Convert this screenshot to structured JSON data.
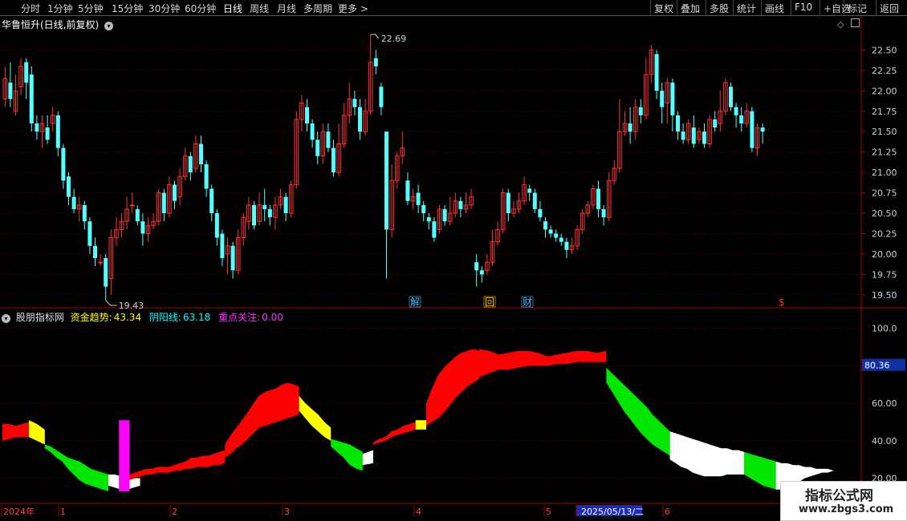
{
  "toolbar": {
    "periods": [
      "分时",
      "1分钟",
      "5分钟",
      "15分钟",
      "30分钟",
      "60分钟",
      "日线",
      "周线",
      "月线",
      "多周期",
      "更多 >"
    ],
    "active_period": "日线",
    "right_buttons": [
      "复权",
      "叠加",
      "多股",
      "统计",
      "画线",
      "F10",
      "+自选",
      "标记",
      "返回"
    ]
  },
  "main_chart": {
    "title": "华鲁恒升(日线,前复权)",
    "high_label": "22.69",
    "low_label": "19.43",
    "y_ticks": [
      "22.50",
      "22.25",
      "22.00",
      "21.75",
      "21.50",
      "21.25",
      "21.00",
      "20.75",
      "20.50",
      "20.25",
      "20.00",
      "19.75",
      "19.50"
    ],
    "markers": [
      {
        "text": "解",
        "color": "#4db8ff"
      },
      {
        "text": "回",
        "color": "#ffcc00"
      },
      {
        "text": "财",
        "color": "#4db8ff"
      },
      {
        "text": "$",
        "color": "#ff3030"
      }
    ]
  },
  "indicator": {
    "name": "股朋指标网",
    "fields": [
      {
        "label": "资金趋势:",
        "value": "43.34",
        "color": "#ffff00"
      },
      {
        "label": "阴阳线:",
        "value": "63.18",
        "color": "#00ffff"
      },
      {
        "label": "重点关注:",
        "value": "0.00",
        "color": "#ff33ff"
      }
    ],
    "y_ticks": [
      "100.0",
      "80.00",
      "60.00",
      "40.00",
      "20.00"
    ],
    "current_value": "80.36"
  },
  "time_axis": {
    "labels": [
      "2024年",
      "1",
      "2",
      "3",
      "4",
      "5",
      "2025/05/13/二",
      "6"
    ]
  },
  "watermark": {
    "line1": "指标公式网",
    "line2": "www.zbgs3.com"
  },
  "colors": {
    "up": "#ff3232",
    "down": "#54ffff",
    "red": "#ff0000",
    "yellow": "#ffff00",
    "green": "#00e600",
    "white": "#ffffff",
    "magenta": "#ff00ff"
  },
  "chart_data": {
    "type": "candlestick",
    "y_range": [
      19.4,
      22.72
    ],
    "candles": [
      [
        21.9,
        22.15,
        22.3,
        21.8
      ],
      [
        22.1,
        21.9,
        22.35,
        21.8
      ],
      [
        21.75,
        22.0,
        22.2,
        21.7
      ],
      [
        22.05,
        22.3,
        22.4,
        21.95
      ],
      [
        22.35,
        22.1,
        22.4,
        21.9
      ],
      [
        22.2,
        21.6,
        22.3,
        21.5
      ],
      [
        21.6,
        21.5,
        21.7,
        21.4
      ],
      [
        21.5,
        21.6,
        21.7,
        21.3
      ],
      [
        21.55,
        21.4,
        21.7,
        21.35
      ],
      [
        21.6,
        21.7,
        21.8,
        21.5
      ],
      [
        21.7,
        21.3,
        21.75,
        21.2
      ],
      [
        21.3,
        20.9,
        21.35,
        20.8
      ],
      [
        20.95,
        20.7,
        21.0,
        20.6
      ],
      [
        20.7,
        20.55,
        20.8,
        20.5
      ],
      [
        20.55,
        20.6,
        20.7,
        20.4
      ],
      [
        20.6,
        20.4,
        20.65,
        20.3
      ],
      [
        20.4,
        20.1,
        20.45,
        20.0
      ],
      [
        20.1,
        19.95,
        20.2,
        19.85
      ],
      [
        19.9,
        19.9,
        20.0,
        19.85
      ],
      [
        19.95,
        19.6,
        20.0,
        19.43
      ],
      [
        19.7,
        20.2,
        20.3,
        19.5
      ],
      [
        20.2,
        20.3,
        20.45,
        20.1
      ],
      [
        20.3,
        20.4,
        20.5,
        20.2
      ],
      [
        20.4,
        20.55,
        20.7,
        20.3
      ],
      [
        20.6,
        20.6,
        20.75,
        20.5
      ],
      [
        20.55,
        20.4,
        20.6,
        20.35
      ],
      [
        20.4,
        20.25,
        20.5,
        20.1
      ],
      [
        20.25,
        20.35,
        20.45,
        20.15
      ],
      [
        20.35,
        20.4,
        20.5,
        20.3
      ],
      [
        20.4,
        20.75,
        20.8,
        20.35
      ],
      [
        20.75,
        20.5,
        20.8,
        20.4
      ],
      [
        20.5,
        20.85,
        20.95,
        20.45
      ],
      [
        20.85,
        20.65,
        20.9,
        20.55
      ],
      [
        20.7,
        20.95,
        21.05,
        20.6
      ],
      [
        20.95,
        21.2,
        21.3,
        20.9
      ],
      [
        21.2,
        21.0,
        21.25,
        20.9
      ],
      [
        21.05,
        21.35,
        21.45,
        21.0
      ],
      [
        21.35,
        21.1,
        21.45,
        21.0
      ],
      [
        21.1,
        20.8,
        21.15,
        20.7
      ],
      [
        20.8,
        20.5,
        20.85,
        20.4
      ],
      [
        20.5,
        20.2,
        20.55,
        20.1
      ],
      [
        20.25,
        19.95,
        20.3,
        19.85
      ],
      [
        20.0,
        20.1,
        20.2,
        19.75
      ],
      [
        20.1,
        19.8,
        20.15,
        19.7
      ],
      [
        19.8,
        20.2,
        20.3,
        19.75
      ],
      [
        20.2,
        20.45,
        20.5,
        20.1
      ],
      [
        20.4,
        20.6,
        20.7,
        20.3
      ],
      [
        20.6,
        20.35,
        20.65,
        20.3
      ],
      [
        20.4,
        20.6,
        20.75,
        20.35
      ],
      [
        20.6,
        20.55,
        20.8,
        20.4
      ],
      [
        20.55,
        20.45,
        20.6,
        20.35
      ],
      [
        20.45,
        20.6,
        20.7,
        20.3
      ],
      [
        20.6,
        20.7,
        20.8,
        20.55
      ],
      [
        20.7,
        20.5,
        20.75,
        20.4
      ],
      [
        20.5,
        20.85,
        20.9,
        20.45
      ],
      [
        20.85,
        21.65,
        21.75,
        20.8
      ],
      [
        21.65,
        21.85,
        21.95,
        21.5
      ],
      [
        21.8,
        21.6,
        21.9,
        21.5
      ],
      [
        21.6,
        21.4,
        21.65,
        21.3
      ],
      [
        21.4,
        21.2,
        21.5,
        21.1
      ],
      [
        21.2,
        21.5,
        21.6,
        21.1
      ],
      [
        21.5,
        21.3,
        21.6,
        21.25
      ],
      [
        21.3,
        21.0,
        21.4,
        20.95
      ],
      [
        21.0,
        21.35,
        21.6,
        20.95
      ],
      [
        21.35,
        21.7,
        21.85,
        21.3
      ],
      [
        21.7,
        21.9,
        22.1,
        21.6
      ],
      [
        21.9,
        21.8,
        22.0,
        21.7
      ],
      [
        21.8,
        21.5,
        21.9,
        21.4
      ],
      [
        21.5,
        21.75,
        21.9,
        21.45
      ],
      [
        21.75,
        22.35,
        22.69,
        21.7
      ],
      [
        22.4,
        22.3,
        22.5,
        22.2
      ],
      [
        22.05,
        21.8,
        22.1,
        21.7
      ],
      [
        21.5,
        20.3,
        21.5,
        19.7
      ],
      [
        20.3,
        20.9,
        21.1,
        20.2
      ],
      [
        20.9,
        21.2,
        21.25,
        20.8
      ],
      [
        21.2,
        21.3,
        21.5,
        21.1
      ],
      [
        20.9,
        20.65,
        21.0,
        20.6
      ],
      [
        20.65,
        20.7,
        20.8,
        20.55
      ],
      [
        20.75,
        20.6,
        20.85,
        20.5
      ],
      [
        20.6,
        20.5,
        20.65,
        20.4
      ],
      [
        20.45,
        20.4,
        20.5,
        20.3
      ],
      [
        20.4,
        20.2,
        20.45,
        20.15
      ],
      [
        20.3,
        20.55,
        20.6,
        20.25
      ],
      [
        20.55,
        20.4,
        20.6,
        20.35
      ],
      [
        20.4,
        20.5,
        20.7,
        20.35
      ],
      [
        20.5,
        20.65,
        20.75,
        20.45
      ],
      [
        20.65,
        20.55,
        20.7,
        20.45
      ],
      [
        20.55,
        20.6,
        20.75,
        20.5
      ],
      [
        20.6,
        20.7,
        20.8,
        20.55
      ],
      [
        19.9,
        19.8,
        20.0,
        19.6
      ],
      [
        19.8,
        19.75,
        19.85,
        19.65
      ],
      [
        19.8,
        19.9,
        20.0,
        19.75
      ],
      [
        19.9,
        20.15,
        20.3,
        19.85
      ],
      [
        20.15,
        20.3,
        20.4,
        20.1
      ],
      [
        20.3,
        20.75,
        20.8,
        20.25
      ],
      [
        20.75,
        20.5,
        20.8,
        20.4
      ],
      [
        20.5,
        20.55,
        20.65,
        20.45
      ],
      [
        20.55,
        20.65,
        20.75,
        20.5
      ],
      [
        20.65,
        20.85,
        20.95,
        20.6
      ],
      [
        20.8,
        20.75,
        20.85,
        20.65
      ],
      [
        20.75,
        20.55,
        20.8,
        20.5
      ],
      [
        20.55,
        20.45,
        20.65,
        20.4
      ],
      [
        20.4,
        20.3,
        20.45,
        20.2
      ],
      [
        20.3,
        20.25,
        20.35,
        20.2
      ],
      [
        20.25,
        20.2,
        20.3,
        20.15
      ],
      [
        20.2,
        20.15,
        20.25,
        20.1
      ],
      [
        20.15,
        20.05,
        20.2,
        19.95
      ],
      [
        20.05,
        20.1,
        20.2,
        20.0
      ],
      [
        20.1,
        20.3,
        20.35,
        20.05
      ],
      [
        20.3,
        20.5,
        20.55,
        20.25
      ],
      [
        20.5,
        20.6,
        20.65,
        20.45
      ],
      [
        20.6,
        20.8,
        20.85,
        20.55
      ],
      [
        20.8,
        20.55,
        20.9,
        20.45
      ],
      [
        20.55,
        20.45,
        20.6,
        20.35
      ],
      [
        20.45,
        20.9,
        21.0,
        20.4
      ],
      [
        20.9,
        21.05,
        21.15,
        20.85
      ],
      [
        21.05,
        21.5,
        21.9,
        21.0
      ],
      [
        21.5,
        21.6,
        21.75,
        21.45
      ],
      [
        21.6,
        21.5,
        21.8,
        21.35
      ],
      [
        21.5,
        21.8,
        21.9,
        21.4
      ],
      [
        21.8,
        21.7,
        21.9,
        21.6
      ],
      [
        21.7,
        22.2,
        22.4,
        21.65
      ],
      [
        22.2,
        22.5,
        22.56,
        22.1
      ],
      [
        22.45,
        22.0,
        22.5,
        21.9
      ],
      [
        22.0,
        21.8,
        22.1,
        21.6
      ],
      [
        21.85,
        22.1,
        22.15,
        21.6
      ],
      [
        22.1,
        21.7,
        22.15,
        21.5
      ],
      [
        21.7,
        21.5,
        21.75,
        21.4
      ],
      [
        21.5,
        21.4,
        21.6,
        21.35
      ],
      [
        21.4,
        21.6,
        21.65,
        21.35
      ],
      [
        21.55,
        21.35,
        21.7,
        21.3
      ],
      [
        21.4,
        21.5,
        21.55,
        21.35
      ],
      [
        21.5,
        21.35,
        21.6,
        21.3
      ],
      [
        21.35,
        21.65,
        21.7,
        21.3
      ],
      [
        21.65,
        21.55,
        21.75,
        21.5
      ],
      [
        21.6,
        21.75,
        22.0,
        21.5
      ],
      [
        21.75,
        22.1,
        22.15,
        21.7
      ],
      [
        22.05,
        21.8,
        22.1,
        21.75
      ],
      [
        21.8,
        21.7,
        21.85,
        21.55
      ],
      [
        21.7,
        21.6,
        21.8,
        21.5
      ],
      [
        21.6,
        21.75,
        21.85,
        21.55
      ],
      [
        21.75,
        21.3,
        21.8,
        21.25
      ],
      [
        21.3,
        21.55,
        21.6,
        21.2
      ],
      [
        21.55,
        21.5,
        21.6,
        21.35
      ]
    ],
    "indicator_y_range": [
      10,
      105
    ],
    "indicator_areas": [
      {
        "color": "#ff0000",
        "from": 0,
        "to": 5,
        "upper": [
          49,
          49,
          48,
          49,
          50
        ],
        "lower": [
          40,
          41,
          42,
          42,
          42
        ]
      },
      {
        "color": "#ffff00",
        "from": 5,
        "to": 8,
        "upper": [
          51,
          49,
          46
        ],
        "lower": [
          42,
          40,
          38
        ]
      },
      {
        "color": "#00e600",
        "from": 8,
        "to": 20,
        "upper": [
          38,
          37,
          35,
          33,
          31,
          30,
          29,
          27,
          25,
          24,
          23,
          22
        ],
        "lower": [
          36,
          34,
          31,
          29,
          25,
          22,
          19,
          17,
          16,
          15,
          14,
          13
        ]
      },
      {
        "color": "#ffffff",
        "from": 20,
        "to": 26,
        "upper": [
          22,
          22,
          21,
          21,
          20,
          20
        ],
        "lower": [
          16,
          15,
          14,
          14,
          15,
          16
        ]
      },
      {
        "color": "#ff00ff",
        "from": 22,
        "to": 24,
        "upper": [
          51,
          51
        ],
        "lower": [
          13,
          13
        ]
      },
      {
        "color": "#ff0000",
        "from": 24,
        "to": 42,
        "upper": [
          22,
          23,
          24,
          25,
          25,
          26,
          26,
          26,
          27,
          28,
          29,
          31,
          31,
          32,
          32,
          33,
          34,
          35
        ],
        "lower": [
          19,
          20,
          21,
          22,
          22,
          23,
          23,
          23,
          24,
          24,
          25,
          25,
          26,
          26,
          26,
          27,
          27,
          28
        ]
      },
      {
        "color": "#ff0000",
        "from": 42,
        "to": 56,
        "upper": [
          38,
          43,
          47,
          51,
          55,
          60,
          64,
          66,
          67,
          68,
          70,
          71,
          70,
          69
        ],
        "lower": [
          31,
          33,
          36,
          38,
          41,
          44,
          47,
          48,
          49,
          50,
          51,
          52,
          53,
          54
        ]
      },
      {
        "color": "#ffff00",
        "from": 56,
        "to": 62,
        "upper": [
          64,
          60,
          57,
          54,
          50,
          47
        ],
        "lower": [
          56,
          52,
          48,
          45,
          42,
          40
        ]
      },
      {
        "color": "#00e600",
        "from": 62,
        "to": 68,
        "upper": [
          41,
          40,
          39,
          38,
          36,
          34
        ],
        "lower": [
          37,
          34,
          31,
          27,
          25,
          24
        ]
      },
      {
        "color": "#ffffff",
        "from": 68,
        "to": 70,
        "upper": [
          33,
          35
        ],
        "lower": [
          27,
          28
        ]
      },
      {
        "color": "#ff0000",
        "from": 70,
        "to": 78,
        "upper": [
          39,
          41,
          42,
          45,
          46,
          48,
          49,
          50
        ],
        "lower": [
          38,
          39,
          40,
          42,
          43,
          44,
          45,
          46
        ]
      },
      {
        "color": "#ffff00",
        "from": 78,
        "to": 80,
        "upper": [
          51,
          51
        ],
        "lower": [
          46,
          46
        ]
      },
      {
        "color": "#ff0000",
        "from": 80,
        "to": 90,
        "upper": [
          60,
          68,
          75,
          79,
          82,
          85,
          87,
          88,
          89,
          88
        ],
        "lower": [
          48,
          50,
          52,
          55,
          59,
          63,
          66,
          69,
          71,
          73
        ]
      },
      {
        "color": "#ff0000",
        "from": 90,
        "to": 114,
        "upper": [
          89,
          88,
          86,
          87,
          88,
          88,
          87,
          85,
          86,
          87,
          88,
          88,
          87,
          88
        ],
        "lower": [
          74,
          76,
          78,
          78,
          79,
          80,
          80,
          80,
          81,
          81,
          82,
          82,
          82,
          82
        ]
      },
      {
        "color": "#00e600",
        "from": 114,
        "to": 126,
        "upper": [
          79,
          76,
          73,
          70,
          67,
          64,
          61,
          58,
          54,
          51,
          48,
          45
        ],
        "lower": [
          71,
          66,
          61,
          56,
          52,
          48,
          44,
          41,
          38,
          36,
          34,
          32
        ]
      },
      {
        "color": "#ffffff",
        "from": 126,
        "to": 140,
        "upper": [
          45,
          44,
          43,
          42,
          41,
          40,
          39,
          38,
          37,
          36,
          36,
          35,
          35,
          34
        ],
        "lower": [
          30,
          28,
          26,
          25,
          23,
          22,
          21,
          21,
          21,
          21,
          22,
          22,
          22,
          22
        ]
      },
      {
        "color": "#00e600",
        "from": 140,
        "to": 146,
        "upper": [
          34,
          33,
          32,
          31,
          30,
          29
        ],
        "lower": [
          22,
          20,
          18,
          16,
          15,
          14
        ]
      },
      {
        "color": "#ffffff",
        "from": 146,
        "to": 158,
        "upper": [
          29,
          28,
          28,
          27,
          27,
          26,
          26,
          25,
          25,
          25,
          24,
          24
        ],
        "lower": [
          14,
          14,
          15,
          16,
          18,
          20,
          21,
          22,
          23,
          23,
          24,
          24
        ]
      }
    ]
  }
}
